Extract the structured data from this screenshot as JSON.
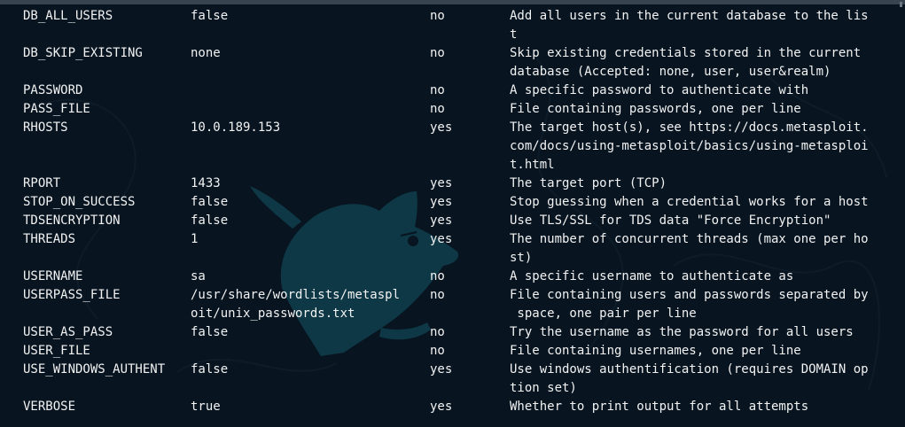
{
  "options": [
    {
      "name": "DB_ALL_USERS",
      "current": [
        "false"
      ],
      "required": "no",
      "description": [
        "Add all users in the current database to the lis",
        "t"
      ]
    },
    {
      "name": "DB_SKIP_EXISTING",
      "current": [
        "none"
      ],
      "required": "no",
      "description": [
        "Skip existing credentials stored in the current",
        "database (Accepted: none, user, user&realm)"
      ]
    },
    {
      "name": "PASSWORD",
      "current": [
        ""
      ],
      "required": "no",
      "description": [
        "A specific password to authenticate with"
      ]
    },
    {
      "name": "PASS_FILE",
      "current": [
        ""
      ],
      "required": "no",
      "description": [
        "File containing passwords, one per line"
      ]
    },
    {
      "name": "RHOSTS",
      "current": [
        "10.0.189.153"
      ],
      "required": "yes",
      "description": [
        "The target host(s), see https://docs.metasploit.",
        "com/docs/using-metasploit/basics/using-metasploi",
        "t.html"
      ]
    },
    {
      "name": "RPORT",
      "current": [
        "1433"
      ],
      "required": "yes",
      "description": [
        "The target port (TCP)"
      ]
    },
    {
      "name": "STOP_ON_SUCCESS",
      "current": [
        "false"
      ],
      "required": "yes",
      "description": [
        "Stop guessing when a credential works for a host"
      ]
    },
    {
      "name": "TDSENCRYPTION",
      "current": [
        "false"
      ],
      "required": "yes",
      "description": [
        "Use TLS/SSL for TDS data \"Force Encryption\""
      ]
    },
    {
      "name": "THREADS",
      "current": [
        "1"
      ],
      "required": "yes",
      "description": [
        "The number of concurrent threads (max one per ho",
        "st)"
      ]
    },
    {
      "name": "USERNAME",
      "current": [
        "sa"
      ],
      "required": "no",
      "description": [
        "A specific username to authenticate as"
      ]
    },
    {
      "name": "USERPASS_FILE",
      "current": [
        "/usr/share/wordlists/metaspl",
        "oit/unix_passwords.txt"
      ],
      "required": "no",
      "description": [
        "File containing users and passwords separated by",
        " space, one pair per line"
      ]
    },
    {
      "name": "USER_AS_PASS",
      "current": [
        "false"
      ],
      "required": "no",
      "description": [
        "Try the username as the password for all users"
      ]
    },
    {
      "name": "USER_FILE",
      "current": [
        ""
      ],
      "required": "no",
      "description": [
        "File containing usernames, one per line"
      ]
    },
    {
      "name": "USE_WINDOWS_AUTHENT",
      "current": [
        "false"
      ],
      "required": "yes",
      "description": [
        "Use windows authentification (requires DOMAIN op",
        "tion set)"
      ]
    },
    {
      "name": "VERBOSE",
      "current": [
        "true"
      ],
      "required": "yes",
      "description": [
        "Whether to print output for all attempts"
      ]
    }
  ],
  "theme": {
    "background": "#081521",
    "foreground": "#f2f2f2",
    "watermark": "#0e3846"
  }
}
